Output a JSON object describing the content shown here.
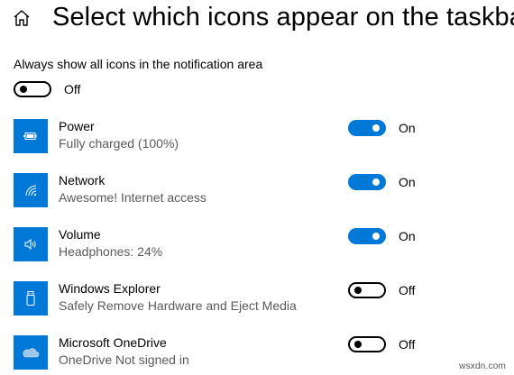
{
  "header": {
    "title": "Select which icons appear on the taskbar"
  },
  "master": {
    "label": "Always show all icons in the notification area",
    "state": "Off"
  },
  "items": [
    {
      "name": "Power",
      "status": "Fully charged (100%)",
      "state": "On",
      "icon": "battery-icon"
    },
    {
      "name": "Network",
      "status": "Awesome! Internet access",
      "state": "On",
      "icon": "wifi-icon"
    },
    {
      "name": "Volume",
      "status": "Headphones: 24%",
      "state": "On",
      "icon": "speaker-icon"
    },
    {
      "name": "Windows Explorer",
      "status": "Safely Remove Hardware and Eject Media",
      "state": "Off",
      "icon": "usb-drive-icon"
    },
    {
      "name": "Microsoft OneDrive",
      "status": "OneDrive Not signed in",
      "state": "Off",
      "icon": "cloud-icon"
    }
  ],
  "watermark": "wsxdn.com",
  "colors": {
    "accent": "#0078d7",
    "secondary_text": "#5a5a5a"
  }
}
